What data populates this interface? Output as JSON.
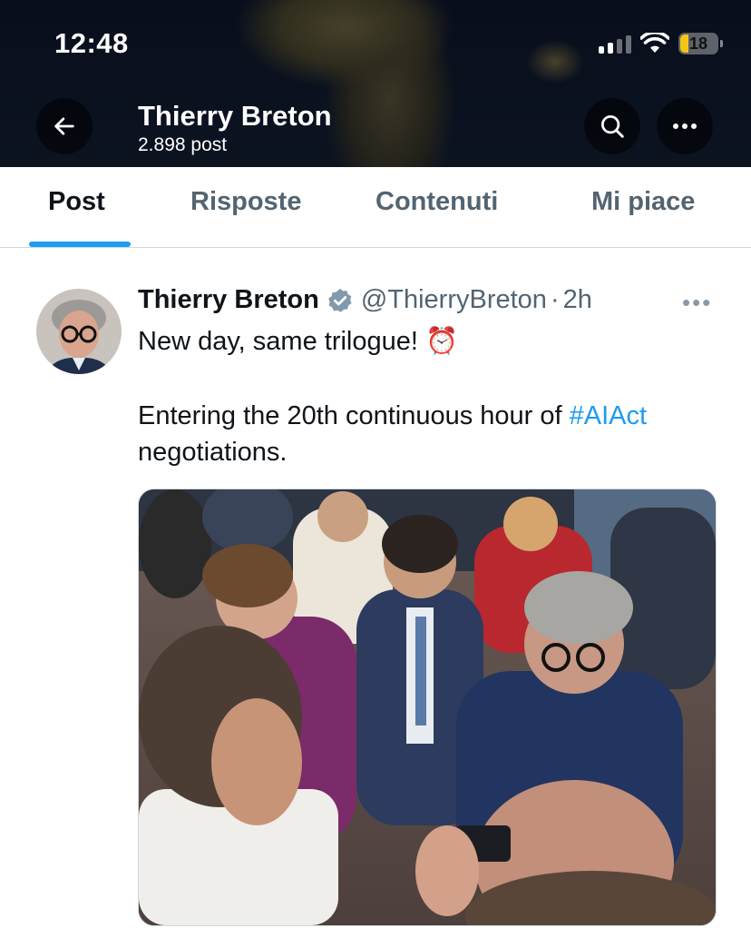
{
  "status_bar": {
    "time": "12:48",
    "battery": "18"
  },
  "header": {
    "name": "Thierry Breton",
    "post_count": "2.898 post"
  },
  "tabs": [
    {
      "label": "Post"
    },
    {
      "label": "Risposte"
    },
    {
      "label": "Contenuti"
    },
    {
      "label": "Mi piace"
    }
  ],
  "post": {
    "author_name": "Thierry Breton",
    "handle": "@ThierryBreton",
    "separator": "·",
    "time": "2h",
    "line1": "New day, same trilogue! ⏰",
    "line2_prefix": "Entering the 20th continuous hour of ",
    "hashtag": "#AIAct",
    "line3": "negotiations."
  },
  "colors": {
    "accent": "#1d9bf0",
    "text": "#0f1419",
    "muted": "#536471",
    "battery": "#f5c419"
  },
  "icons": [
    "back-arrow-icon",
    "search-icon",
    "more-icon",
    "verified-badge-icon",
    "signal-icon",
    "wifi-icon",
    "battery-icon"
  ]
}
